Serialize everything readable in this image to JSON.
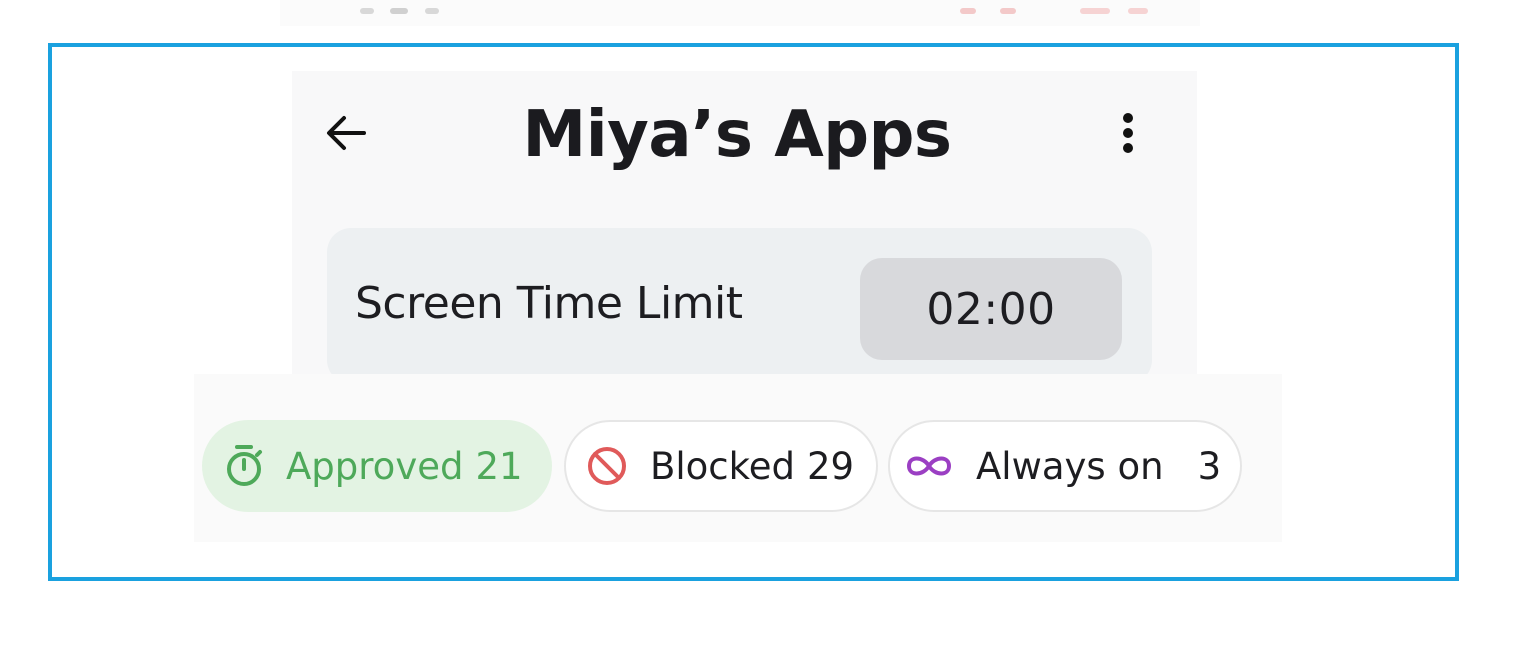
{
  "header": {
    "title": "Miya’s Apps",
    "back_icon": "arrow-left-icon",
    "menu_icon": "more-vertical-icon"
  },
  "screen_time": {
    "label": "Screen Time Limit",
    "value": "02:00"
  },
  "filters": [
    {
      "label": "Approved",
      "count": "21",
      "icon": "timer-icon",
      "color": "#4ea95a",
      "selected": true
    },
    {
      "label": "Blocked",
      "count": "29",
      "icon": "blocked-icon",
      "color": "#e05a5a",
      "selected": false
    },
    {
      "label": "Always on",
      "count": "3",
      "icon": "infinity-icon",
      "color": "#9b3fc3",
      "selected": false
    }
  ],
  "colors": {
    "frame_border": "#1aa1df",
    "approved_bg": "#e3f3e3",
    "card_bg": "#edf0f2",
    "value_bg": "#d8d9dc"
  }
}
